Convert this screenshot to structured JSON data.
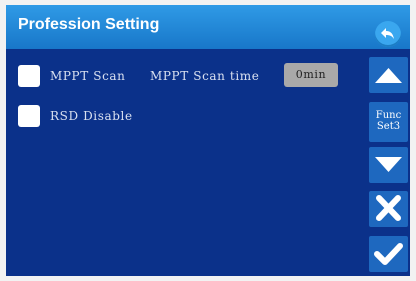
{
  "header": {
    "title": "Profession Setting"
  },
  "options": {
    "mppt_scan_label": "MPPT Scan",
    "mppt_scan_time_label": "MPPT Scan time",
    "mppt_scan_time_value": "0min",
    "rsd_disable_label": "RSD Disable"
  },
  "sidebar": {
    "func_line1": "Func",
    "func_line2": "Set3"
  },
  "icons": {
    "back": "back-arrow-icon",
    "up": "triangle-up-icon",
    "down": "triangle-down-icon",
    "cancel": "x-icon",
    "confirm": "check-icon"
  },
  "colors": {
    "background": "#0b318a",
    "header": "#1877c9",
    "button": "#1e68bf"
  }
}
